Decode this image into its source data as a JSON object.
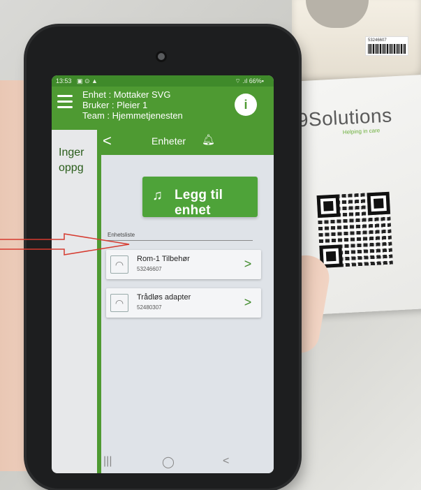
{
  "status_bar": {
    "time": "13:53",
    "indicators": "▣ ⊙ ▲",
    "signal_battery": "⌔ .ıl 66%▪"
  },
  "header": {
    "unit_line": "Enhet : Mottaker SVG",
    "user_line": "Bruker : Pleier 1",
    "team_line": "Team : Hjemmetjenesten",
    "help_icon": "i"
  },
  "background_screen": {
    "line1": "Inger",
    "line2": "oppg"
  },
  "drawer": {
    "back_icon": "<",
    "title": "Enheter",
    "title_icon": "bell-plus-icon",
    "add_button_label": "Legg til enhet",
    "list_label": "Enhetsliste",
    "devices": [
      {
        "name": "Rom-1 Tilbehør",
        "id": "53246607"
      },
      {
        "name": "Trådløs adapter",
        "id": "52480307"
      }
    ]
  },
  "nav_bar": {
    "recent": "|||",
    "home": "◯",
    "back": "<"
  },
  "product_card": {
    "brand": "9Solutions",
    "tagline": "Helping in care"
  },
  "device_label": {
    "code": "53246607"
  },
  "colors": {
    "brand_green": "#4e9a32",
    "button_green": "#4ea339",
    "arrow_red": "#d63a2f"
  }
}
